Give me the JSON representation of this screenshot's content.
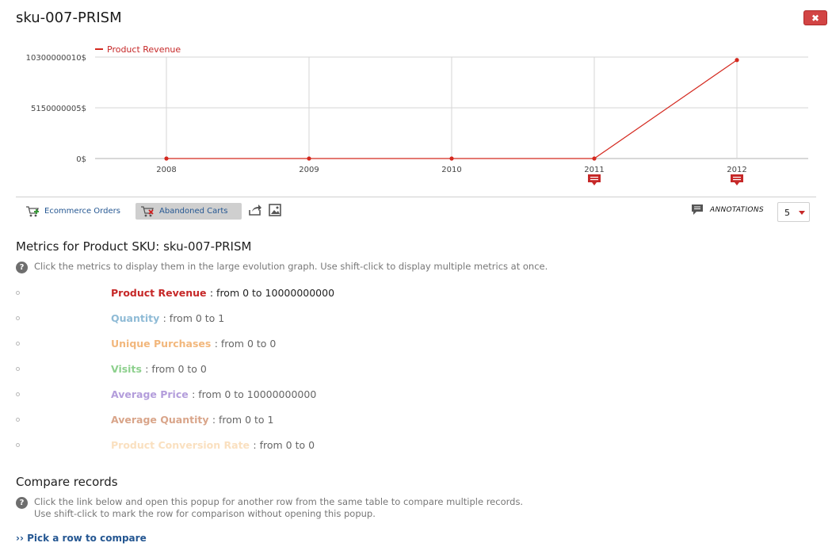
{
  "title": "sku-007-PRISM",
  "close_label": "✖",
  "chart_data": {
    "type": "line",
    "x": [
      "2008",
      "2009",
      "2010",
      "2011",
      "2012"
    ],
    "series": [
      {
        "name": "Product Revenue",
        "values": [
          0,
          0,
          0,
          0,
          10000000000
        ],
        "color": "#d4291f"
      }
    ],
    "y_ticks": [
      0,
      5150000005,
      10300000010
    ],
    "y_tick_labels": [
      "0$",
      "5150000005$",
      "10300000010$"
    ],
    "ylim": [
      0,
      10300000010
    ],
    "annotations_on_x": [
      "2011",
      "2012"
    ],
    "grid": true,
    "legend": "top-left"
  },
  "footer": {
    "ecommerce_orders": "Ecommerce Orders",
    "abandoned_carts": "Abandoned Carts",
    "annotations_label": "ANNOTATIONS",
    "period_value": "5"
  },
  "metrics_heading": "Metrics for Product SKU: sku-007-PRISM",
  "metrics_help": "Click the metrics to display them in the large evolution graph. Use shift-click to display multiple metrics at once.",
  "metrics": [
    {
      "name": "Product Revenue",
      "range": ": from 0 to 10000000000",
      "color": "#c62828",
      "selected": true
    },
    {
      "name": "Quantity",
      "range": ": from 0 to 1",
      "color": "#8fbbd6",
      "selected": false
    },
    {
      "name": "Unique Purchases",
      "range": ": from 0 to 0",
      "color": "#f2b77c",
      "selected": false
    },
    {
      "name": "Visits",
      "range": ": from 0 to 0",
      "color": "#8dd08d",
      "selected": false
    },
    {
      "name": "Average Price",
      "range": ": from 0 to 10000000000",
      "color": "#b39ddb",
      "selected": false
    },
    {
      "name": "Average Quantity",
      "range": ": from 0 to 1",
      "color": "#d9a58a",
      "selected": false
    },
    {
      "name": "Product Conversion Rate",
      "range": ": from 0 to 0",
      "color": "#fae0c0",
      "selected": false
    }
  ],
  "compare_heading": "Compare records",
  "compare_help_line1": "Click the link below and open this popup for another row from the same table to compare multiple records.",
  "compare_help_line2": "Use shift-click to mark the row for comparison without opening this popup.",
  "pick_link": "›› Pick a row to compare"
}
